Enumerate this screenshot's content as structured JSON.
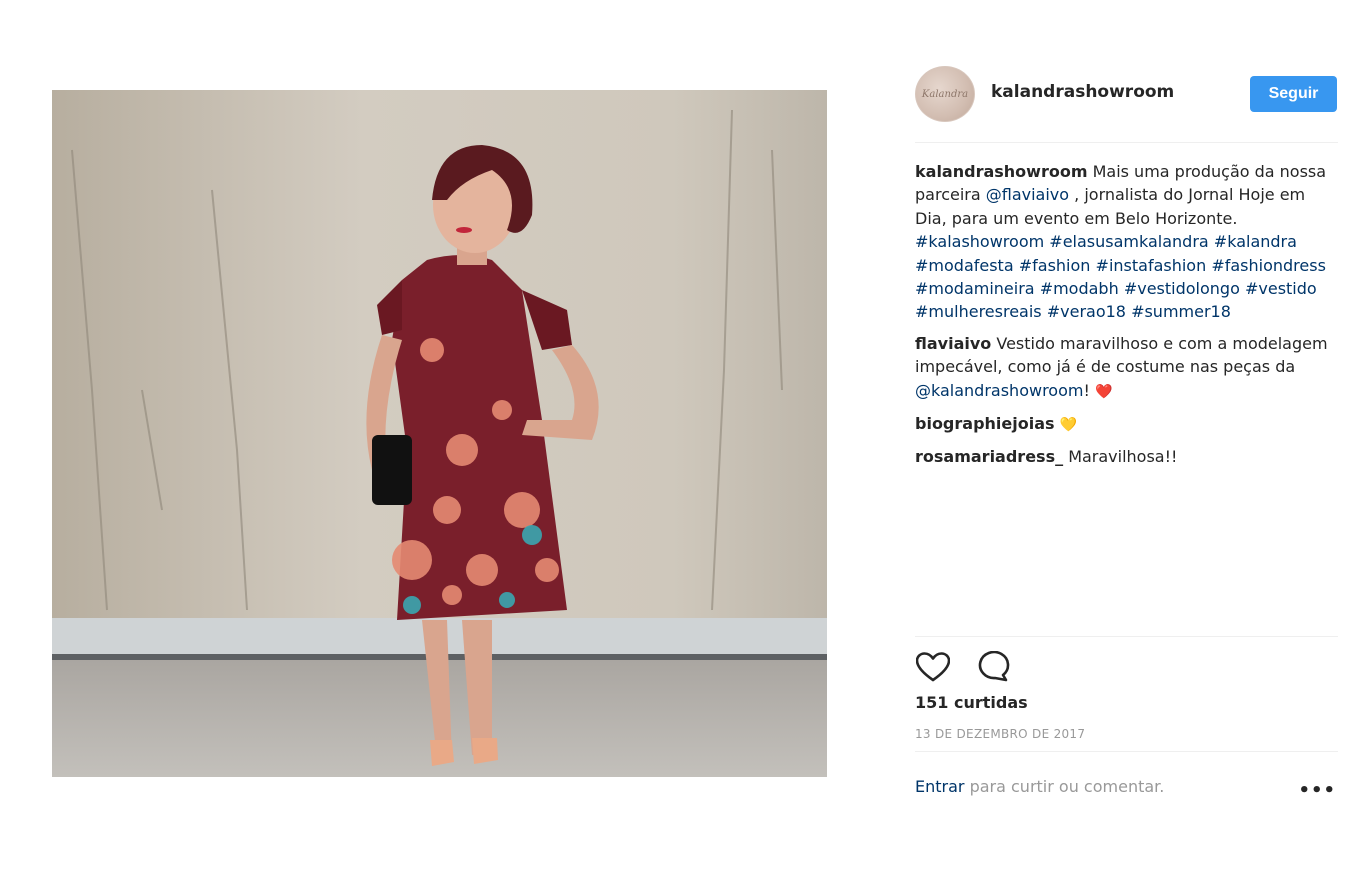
{
  "post": {
    "photo_alt": "",
    "account": {
      "username": "kalandrashowroom",
      "avatar_text": "Kalandra",
      "follow_label": "Seguir"
    },
    "caption": {
      "author": "kalandrashowroom",
      "text_part1": "Mais uma produção da nossa parceira",
      "mention": "@flaviaivo",
      "text_part2": ", jornalista do Jornal Hoje em Dia, para um evento em Belo Horizonte.",
      "hashtags": [
        "#kalashowroom",
        "#elasusamkalandra",
        "#kalandra",
        "#modafesta",
        "#fashion",
        "#instafashion",
        "#fashiondress",
        "#modamineira",
        "#modabh",
        "#vestidolongo",
        "#vestido",
        "#mulheresreais",
        "#verao18",
        "#summer18"
      ]
    },
    "comments": [
      {
        "author": "flaviaivo",
        "text_part1": "Vestido maravilhoso e com a modelagem impecável, como já é de costume nas peças da",
        "mention": "@kalandrashowroom",
        "text_part2": "!",
        "emoji": "❤️"
      },
      {
        "author": "biographiejoias",
        "emoji": "💛"
      },
      {
        "author": "rosamariadress_",
        "text": "Maravilhosa!!"
      }
    ],
    "likes_text": "151 curtidas",
    "date_text": "13 DE DEZEMBRO DE 2017",
    "login": {
      "link": "Entrar",
      "rest": "para curtir ou comentar."
    },
    "more_label": "•••",
    "icons": {
      "like": "heart-icon",
      "comment": "comment-icon"
    },
    "colors": {
      "follow_button": "#3897f0",
      "link": "#003569",
      "muted": "#999999"
    }
  }
}
